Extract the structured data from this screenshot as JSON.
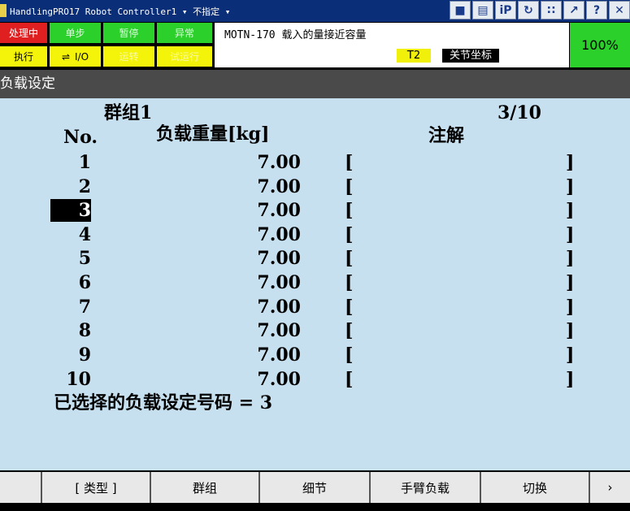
{
  "titlebar": {
    "title": "HandlingPRO17  Robot Controller1 ▾ 不指定 ▾",
    "icons": [
      "trash-icon",
      "keyboard-icon",
      "ip-icon",
      "refresh-icon",
      "step-icon",
      "external-icon",
      "help-icon",
      "close-icon"
    ],
    "icon_glyphs": [
      "■",
      "▤",
      "iP",
      "↻",
      "∷",
      "↗",
      "?",
      "✕"
    ]
  },
  "status": {
    "processing": "处理中",
    "single_step": "单步",
    "hold": "暂停",
    "fault": "异常",
    "running": "执行",
    "io": "I/O",
    "operating": "运转",
    "test_run": "试运行",
    "message": "MOTN-170 载入的量接近容量",
    "mode": "T2",
    "coord_system": "关节坐标",
    "override": "100%"
  },
  "screen": {
    "title": "负载设定",
    "group": "群组1",
    "page": "3/10",
    "col_no": "No.",
    "col_weight": "负载重量[kg]",
    "col_comment": "注解",
    "rows": [
      {
        "no": "1",
        "weight": "7.00",
        "lb": "[",
        "rb": "]"
      },
      {
        "no": "2",
        "weight": "7.00",
        "lb": "[",
        "rb": "]"
      },
      {
        "no": "3",
        "weight": "7.00",
        "lb": "[",
        "rb": "]"
      },
      {
        "no": "4",
        "weight": "7.00",
        "lb": "[",
        "rb": "]"
      },
      {
        "no": "5",
        "weight": "7.00",
        "lb": "[",
        "rb": "]"
      },
      {
        "no": "6",
        "weight": "7.00",
        "lb": "[",
        "rb": "]"
      },
      {
        "no": "7",
        "weight": "7.00",
        "lb": "[",
        "rb": "]"
      },
      {
        "no": "8",
        "weight": "7.00",
        "lb": "[",
        "rb": "]"
      },
      {
        "no": "9",
        "weight": "7.00",
        "lb": "[",
        "rb": "]"
      },
      {
        "no": "10",
        "weight": "7.00",
        "lb": "[",
        "rb": "]"
      }
    ],
    "selected_label": "已选择的负载设定号码 = 3"
  },
  "fkeys": {
    "type": "[ 类型 ]",
    "group": "群组",
    "detail": "细节",
    "arm_load": "手臂负载",
    "switch": "切换",
    "next": "›"
  }
}
